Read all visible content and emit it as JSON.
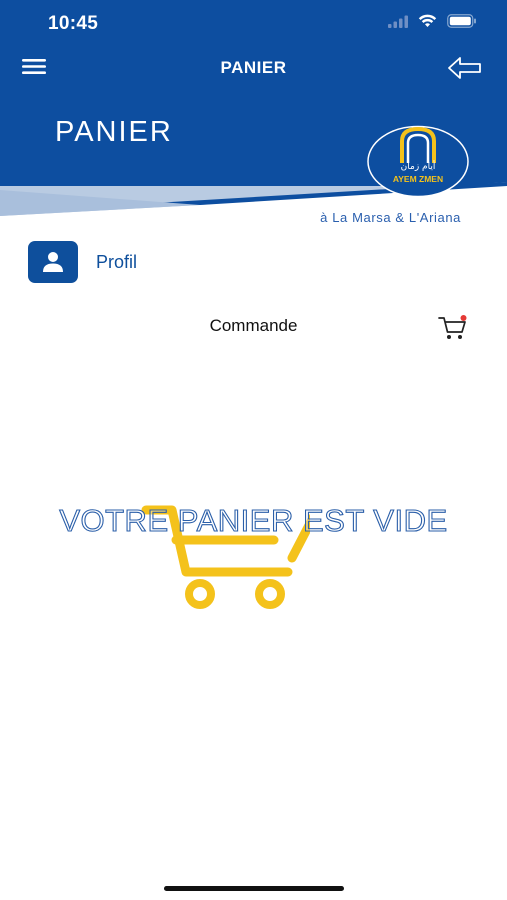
{
  "status_bar": {
    "time": "10:45"
  },
  "nav": {
    "title": "PANIER"
  },
  "header": {
    "title": "PANIER",
    "logo_text": "AYEM ZMEN",
    "logo_arabic": "أيام زمان",
    "tagline": "à La Marsa & L'Ariana"
  },
  "profile": {
    "label": "Profil"
  },
  "order": {
    "label": "Commande"
  },
  "empty_state": {
    "message": "VOTRE PANIER EST VIDE"
  },
  "colors": {
    "brand_blue": "#0e4f9c",
    "header_blue": "#0d4ea0",
    "accent_yellow": "#f4c21b",
    "cart_dot": "#e53935"
  },
  "icons": {
    "menu": "hamburger-icon",
    "back": "arrow-left-icon",
    "profile": "user-icon",
    "cart": "cart-icon",
    "signal": "signal-icon",
    "wifi": "wifi-icon",
    "battery": "battery-icon"
  }
}
